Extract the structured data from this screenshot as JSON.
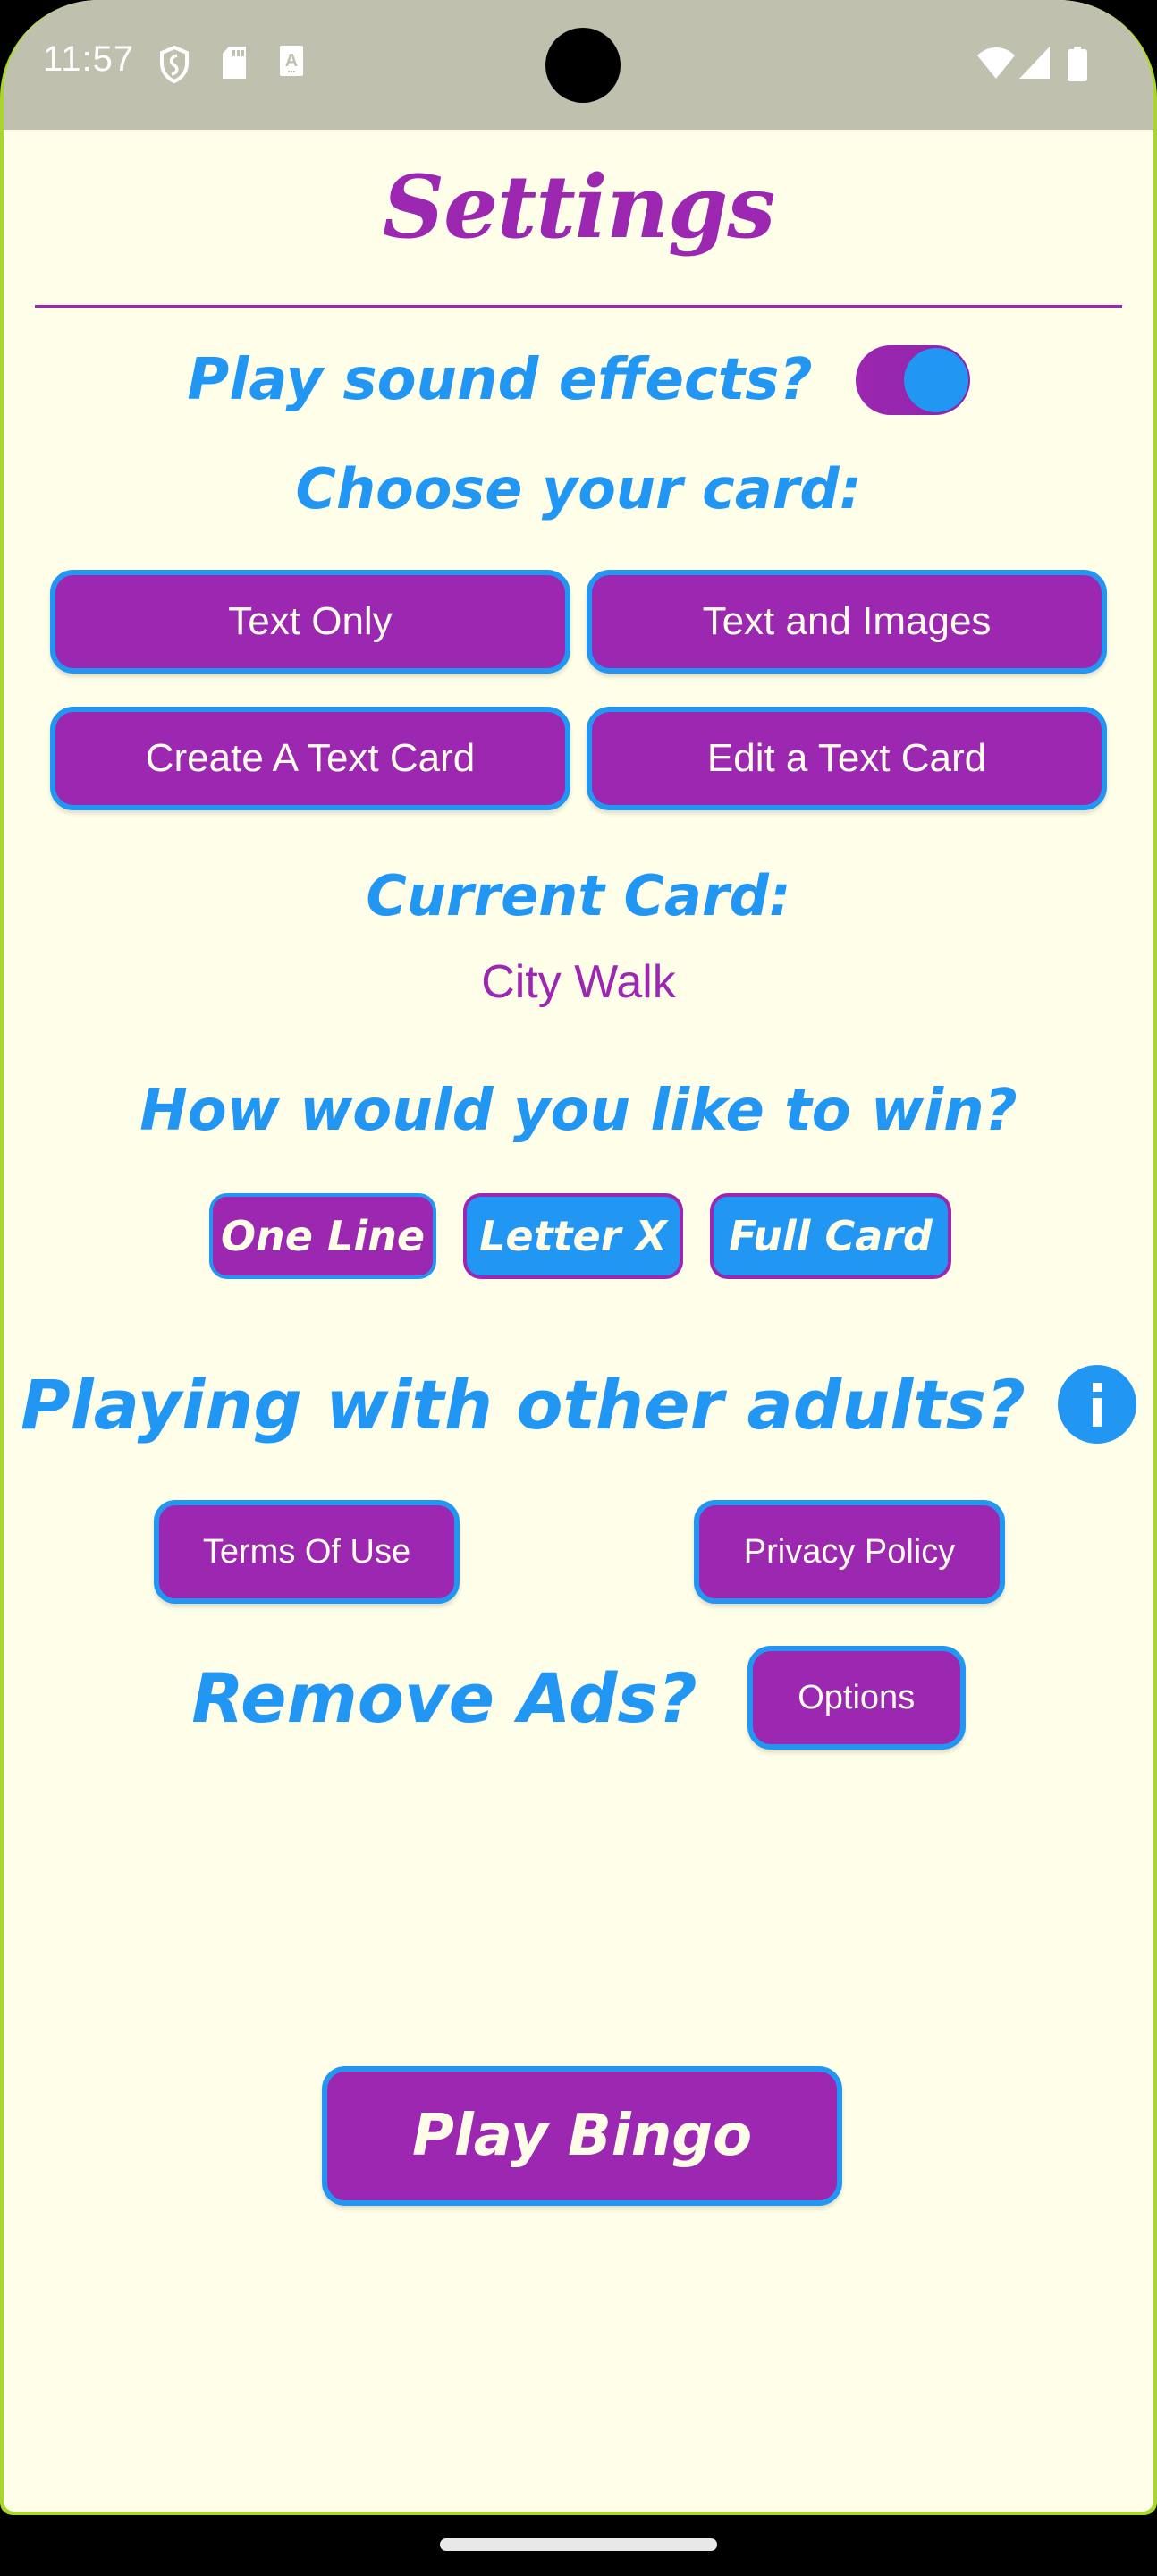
{
  "status_bar": {
    "time": "11:57",
    "left_icons": [
      "shield-icon",
      "sd-card-icon",
      "keyboard-a-icon"
    ],
    "right_icons": [
      "wifi-icon",
      "signal-icon",
      "battery-icon"
    ]
  },
  "page": {
    "title": "Settings"
  },
  "sound": {
    "label": "Play sound effects?",
    "enabled": true
  },
  "card_choice": {
    "label": "Choose your card:",
    "buttons": [
      {
        "label": "Text Only"
      },
      {
        "label": "Text and Images"
      },
      {
        "label": "Create A Text Card"
      },
      {
        "label": "Edit a Text Card"
      }
    ]
  },
  "current_card": {
    "label": "Current Card:",
    "value": "City Walk"
  },
  "win_mode": {
    "label": "How would you like to win?",
    "options": [
      {
        "label": "One Line",
        "selected": true
      },
      {
        "label": "Letter X",
        "selected": false
      },
      {
        "label": "Full Card",
        "selected": false
      }
    ]
  },
  "adults": {
    "label": "Playing with other adults?",
    "info_icon": "info-icon",
    "terms_label": "Terms Of Use",
    "privacy_label": "Privacy Policy"
  },
  "ads": {
    "label": "Remove Ads?",
    "options_label": "Options"
  },
  "play": {
    "label": "Play Bingo"
  },
  "colors": {
    "primary_purple": "#9c27b0",
    "accent_blue": "#2196f3",
    "background": "#fffee8",
    "button_text": "#fffde7"
  }
}
